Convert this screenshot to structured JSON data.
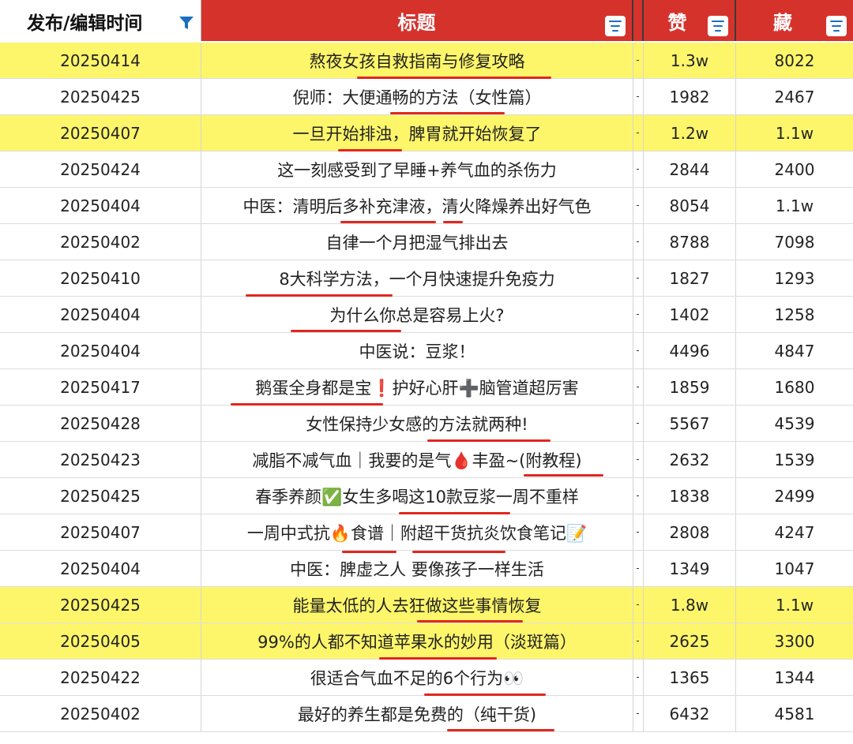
{
  "header": {
    "date_label": "发布/编辑时间",
    "title_label": "标题",
    "likes_label": "赞",
    "saves_label": "藏",
    "filter_icon": "filter-funnel-icon",
    "menu_icon": "column-menu-icon"
  },
  "colors": {
    "header_red": "#d6322c",
    "highlight_yellow": "#fdf66a",
    "underline_red": "#e0271f",
    "menu_blue": "#1a6fc0"
  },
  "rows": [
    {
      "date": "20250414",
      "title": "熬夜女孩自救指南与修复攻略",
      "likes": "1.3w",
      "saves": "8022",
      "highlighted": true
    },
    {
      "date": "20250425",
      "title": "倪师：大便通畅的方法（女性篇）",
      "likes": "1982",
      "saves": "2467",
      "highlighted": false
    },
    {
      "date": "20250407",
      "title": "一旦开始排浊，脾胃就开始恢复了",
      "likes": "1.2w",
      "saves": "1.1w",
      "highlighted": true
    },
    {
      "date": "20250424",
      "title": "这一刻感受到了早睡+养气血的杀伤力",
      "likes": "2844",
      "saves": "2400",
      "highlighted": false
    },
    {
      "date": "20250404",
      "title": "中医：清明后多补充津液，清火降燥养出好气色",
      "likes": "8054",
      "saves": "1.1w",
      "highlighted": false
    },
    {
      "date": "20250402",
      "title": "自律一个月把湿气排出去",
      "likes": "8788",
      "saves": "7098",
      "highlighted": false
    },
    {
      "date": "20250410",
      "title": "8大科学方法，一个月快速提升免疫力",
      "likes": "1827",
      "saves": "1293",
      "highlighted": false
    },
    {
      "date": "20250404",
      "title": "为什么你总是容易上火?",
      "likes": "1402",
      "saves": "1258",
      "highlighted": false
    },
    {
      "date": "20250404",
      "title": "中医说：豆浆！",
      "likes": "4496",
      "saves": "4847",
      "highlighted": false
    },
    {
      "date": "20250417",
      "title": "鹅蛋全身都是宝❗护好心肝➕脑管道超厉害",
      "likes": "1859",
      "saves": "1680",
      "highlighted": false
    },
    {
      "date": "20250428",
      "title": "女性保持少女感的方法就两种!",
      "likes": "5567",
      "saves": "4539",
      "highlighted": false
    },
    {
      "date": "20250423",
      "title": "减脂不减气血｜我要的是气🩸丰盈~(附教程)",
      "likes": "2632",
      "saves": "1539",
      "highlighted": false
    },
    {
      "date": "20250425",
      "title": "春季养颜✅女生多喝这10款豆浆一周不重样",
      "likes": "1838",
      "saves": "2499",
      "highlighted": false
    },
    {
      "date": "20250407",
      "title": "一周中式抗🔥食谱｜附超干货抗炎饮食笔记📝",
      "likes": "2808",
      "saves": "4247",
      "highlighted": false
    },
    {
      "date": "20250404",
      "title": "中医：脾虚之人 要像孩子一样生活",
      "likes": "1349",
      "saves": "1047",
      "highlighted": false
    },
    {
      "date": "20250425",
      "title": "能量太低的人去狂做这些事情恢复",
      "likes": "1.8w",
      "saves": "1.1w",
      "highlighted": true
    },
    {
      "date": "20250405",
      "title": "99%的人都不知道苹果水的妙用（淡斑篇）",
      "likes": "2625",
      "saves": "3300",
      "highlighted": true
    },
    {
      "date": "20250422",
      "title": "很适合气血不足的6个行为👀",
      "likes": "1365",
      "saves": "1344",
      "highlighted": false
    },
    {
      "date": "20250402",
      "title": "最好的养生都是免费的（纯干货)",
      "likes": "6432",
      "saves": "4581",
      "highlighted": false
    }
  ]
}
